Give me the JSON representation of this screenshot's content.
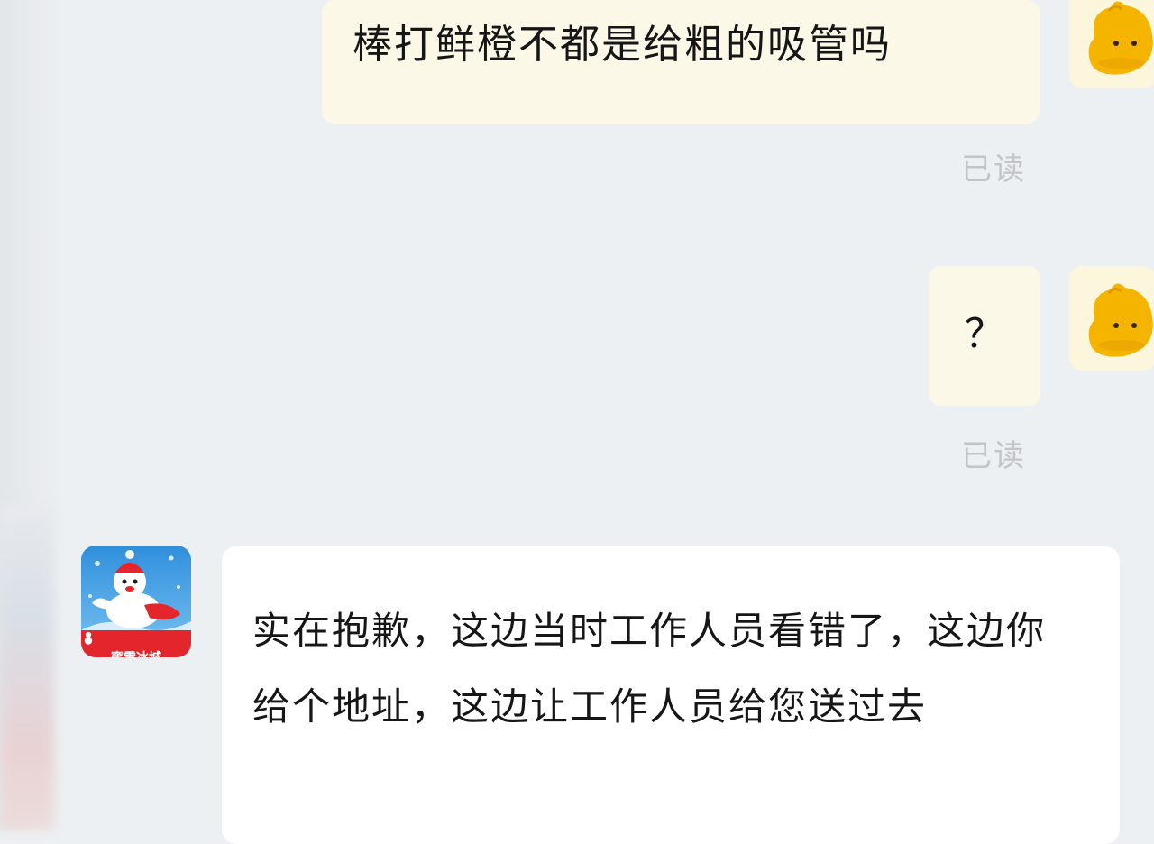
{
  "messages": [
    {
      "sender": "self",
      "text": "棒打鲜橙不都是给粗的吸管吗",
      "status": "已读"
    },
    {
      "sender": "self",
      "text": "？",
      "status": "已读"
    },
    {
      "sender": "merchant",
      "text": "实在抱歉，这边当时工作人员看错了，这边你给个地址，这边让工作人员给您送过去"
    }
  ],
  "merchant": {
    "avatar_icon": "snowman-mascot-icon",
    "brand_label": "蜜雪冰城"
  },
  "self": {
    "avatar_icon": "yellow-blob-avatar-icon"
  },
  "colors": {
    "background": "#edf0f2",
    "sent_bubble": "#fbf8e8",
    "received_bubble": "#ffffff",
    "read_status": "#c2c5c8",
    "brand_red": "#e2262c"
  }
}
